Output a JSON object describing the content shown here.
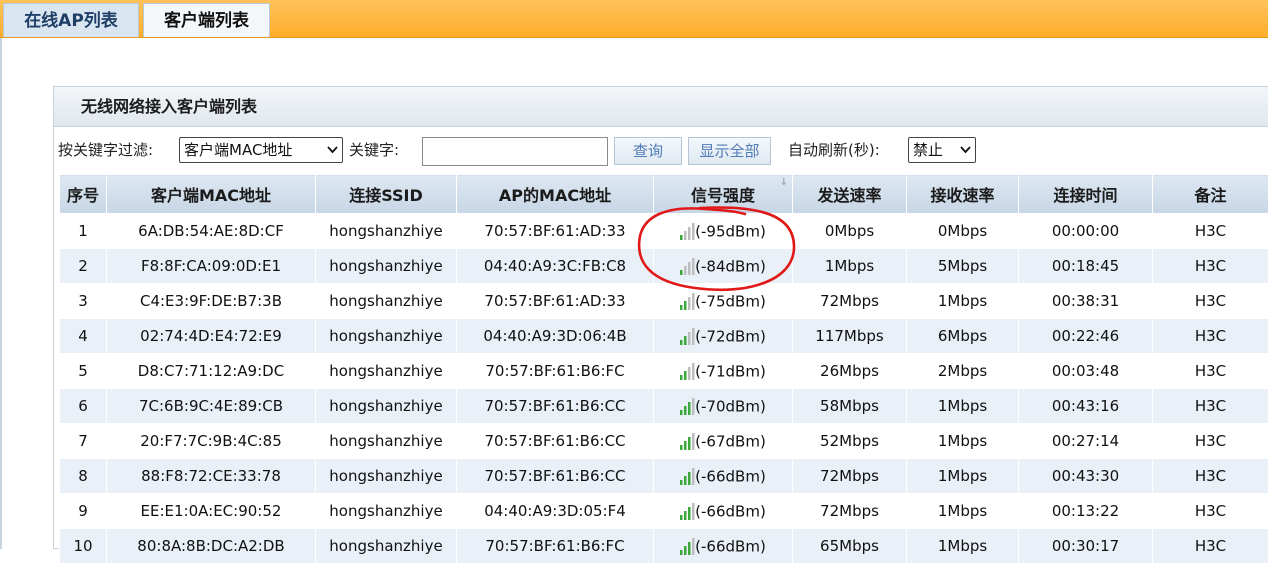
{
  "tabs": [
    {
      "label": "在线AP列表",
      "active": false
    },
    {
      "label": "客户端列表",
      "active": true
    }
  ],
  "panel": {
    "title": "无线网络接入客户端列表"
  },
  "filter": {
    "filter_label": "按关键字过滤:",
    "field_select": "客户端MAC地址",
    "keyword_label": "关键字:",
    "keyword_value": "",
    "query_button": "查询",
    "show_all_button": "显示全部",
    "refresh_label": "自动刷新(秒):",
    "refresh_select": "禁止"
  },
  "table": {
    "headers": [
      "序号",
      "客户端MAC地址",
      "连接SSID",
      "AP的MAC地址",
      "信号强度",
      "发送速率",
      "接收速率",
      "连接时间",
      "备注"
    ],
    "rows": [
      {
        "no": "1",
        "mac": "6A:DB:54:AE:8D:CF",
        "ssid": "hongshanzhiye",
        "ap_mac": "70:57:BF:61:AD:33",
        "signal": "(-95dBm)",
        "bars": 1,
        "tx": "0Mbps",
        "rx": "0Mbps",
        "time": "00:00:00",
        "note": "H3C"
      },
      {
        "no": "2",
        "mac": "F8:8F:CA:09:0D:E1",
        "ssid": "hongshanzhiye",
        "ap_mac": "04:40:A9:3C:FB:C8",
        "signal": "(-84dBm)",
        "bars": 1,
        "tx": "1Mbps",
        "rx": "5Mbps",
        "time": "00:18:45",
        "note": "H3C"
      },
      {
        "no": "3",
        "mac": "C4:E3:9F:DE:B7:3B",
        "ssid": "hongshanzhiye",
        "ap_mac": "70:57:BF:61:AD:33",
        "signal": "(-75dBm)",
        "bars": 2,
        "tx": "72Mbps",
        "rx": "1Mbps",
        "time": "00:38:31",
        "note": "H3C"
      },
      {
        "no": "4",
        "mac": "02:74:4D:E4:72:E9",
        "ssid": "hongshanzhiye",
        "ap_mac": "04:40:A9:3D:06:4B",
        "signal": "(-72dBm)",
        "bars": 2,
        "tx": "117Mbps",
        "rx": "6Mbps",
        "time": "00:22:46",
        "note": "H3C"
      },
      {
        "no": "5",
        "mac": "D8:C7:71:12:A9:DC",
        "ssid": "hongshanzhiye",
        "ap_mac": "70:57:BF:61:B6:FC",
        "signal": "(-71dBm)",
        "bars": 2,
        "tx": "26Mbps",
        "rx": "2Mbps",
        "time": "00:03:48",
        "note": "H3C"
      },
      {
        "no": "6",
        "mac": "7C:6B:9C:4E:89:CB",
        "ssid": "hongshanzhiye",
        "ap_mac": "70:57:BF:61:B6:CC",
        "signal": "(-70dBm)",
        "bars": 3,
        "tx": "58Mbps",
        "rx": "1Mbps",
        "time": "00:43:16",
        "note": "H3C"
      },
      {
        "no": "7",
        "mac": "20:F7:7C:9B:4C:85",
        "ssid": "hongshanzhiye",
        "ap_mac": "70:57:BF:61:B6:CC",
        "signal": "(-67dBm)",
        "bars": 3,
        "tx": "52Mbps",
        "rx": "1Mbps",
        "time": "00:27:14",
        "note": "H3C"
      },
      {
        "no": "8",
        "mac": "88:F8:72:CE:33:78",
        "ssid": "hongshanzhiye",
        "ap_mac": "70:57:BF:61:B6:CC",
        "signal": "(-66dBm)",
        "bars": 3,
        "tx": "72Mbps",
        "rx": "1Mbps",
        "time": "00:43:30",
        "note": "H3C"
      },
      {
        "no": "9",
        "mac": "EE:E1:0A:EC:90:52",
        "ssid": "hongshanzhiye",
        "ap_mac": "04:40:A9:3D:05:F4",
        "signal": "(-66dBm)",
        "bars": 3,
        "tx": "72Mbps",
        "rx": "1Mbps",
        "time": "00:13:22",
        "note": "H3C"
      },
      {
        "no": "10",
        "mac": "80:8A:8B:DC:A2:DB",
        "ssid": "hongshanzhiye",
        "ap_mac": "70:57:BF:61:B6:FC",
        "signal": "(-66dBm)",
        "bars": 3,
        "tx": "65Mbps",
        "rx": "1Mbps",
        "time": "00:30:17",
        "note": "H3C"
      }
    ]
  },
  "colors": {
    "tabbar": "#ffad2a",
    "header_bg": "#c7d6e6",
    "row_alt": "#e9f0f7",
    "signal_on": "#3aa83a",
    "signal_off": "#bdbdbd",
    "annotation": "#e01818"
  },
  "icons": [
    "signal-strength-icon",
    "chevron-down-icon",
    "sort-arrow-icon"
  ]
}
